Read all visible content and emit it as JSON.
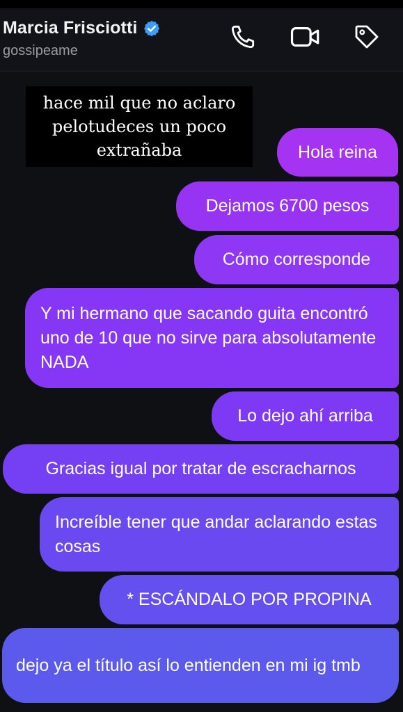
{
  "header": {
    "contact_name": "Marcia Frisciotti",
    "contact_handle": "gossipeame",
    "verified_badge": "verified-badge-icon",
    "icons": [
      "phone-icon",
      "video-camera-icon",
      "tag-icon"
    ]
  },
  "caption": {
    "text": "hace mil que no aclaro\npelotudeces un poco\nextrañaba"
  },
  "messages": [
    {
      "text": "Hola reina"
    },
    {
      "text": "Dejamos 6700 pesos"
    },
    {
      "text": "Cómo corresponde"
    },
    {
      "text": "Y mi hermano que sacando guita encontró uno de 10 que no sirve para absolutamente NADA"
    },
    {
      "text": "Lo dejo ahí arriba"
    },
    {
      "text": "Gracias igual por tratar de escracharnos"
    },
    {
      "text": "Increíble tener que andar aclarando estas cosas"
    },
    {
      "text": "* ESCÁNDALO POR PROPINA"
    },
    {
      "text": "dejo ya el título así lo entienden en mi ig tmb"
    }
  ],
  "colors": {
    "background": "#0f1014",
    "header": "#121318",
    "bubble_gradient_top": "#a433f2",
    "bubble_gradient_bottom": "#5c5aed",
    "verified_blue": "#3b9df8"
  }
}
